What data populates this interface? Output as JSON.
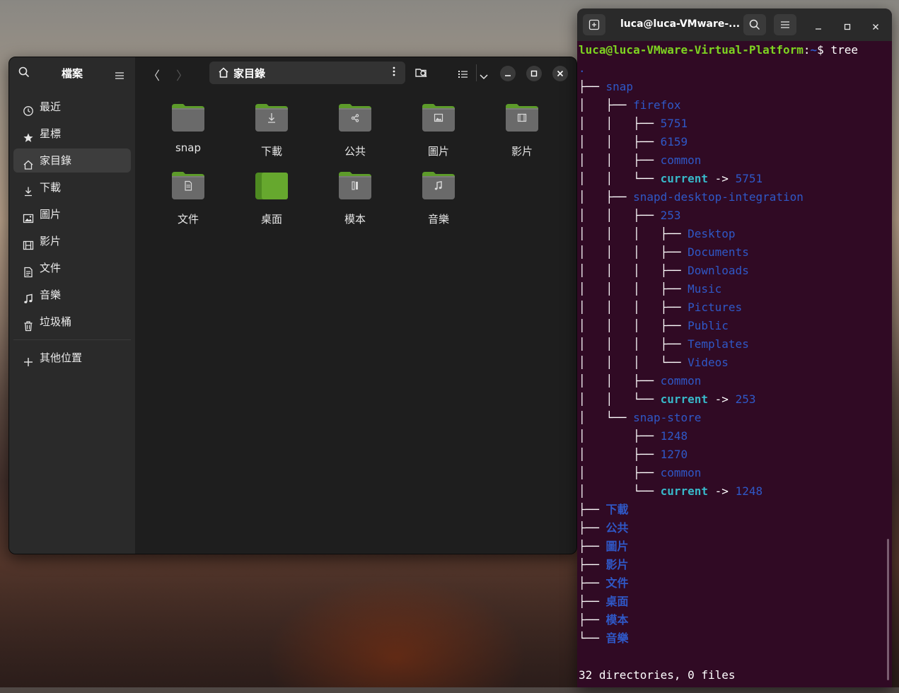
{
  "files": {
    "title": "檔案",
    "path": "家目錄",
    "sidebar": [
      {
        "label": "最近",
        "icon": "clock-icon"
      },
      {
        "label": "星標",
        "icon": "star-icon"
      },
      {
        "label": "家目錄",
        "icon": "home-icon"
      },
      {
        "label": "下載",
        "icon": "download-icon"
      },
      {
        "label": "圖片",
        "icon": "picture-icon"
      },
      {
        "label": "影片",
        "icon": "film-icon"
      },
      {
        "label": "文件",
        "icon": "document-icon"
      },
      {
        "label": "音樂",
        "icon": "music-icon"
      },
      {
        "label": "垃圾桶",
        "icon": "trash-icon"
      }
    ],
    "other_locations": "其他位置",
    "items": [
      {
        "label": "snap",
        "icon": "folder-icon"
      },
      {
        "label": "下載",
        "icon": "folder-download-icon"
      },
      {
        "label": "公共",
        "icon": "folder-share-icon"
      },
      {
        "label": "圖片",
        "icon": "folder-picture-icon"
      },
      {
        "label": "影片",
        "icon": "folder-video-icon"
      },
      {
        "label": "文件",
        "icon": "folder-document-icon"
      },
      {
        "label": "桌面",
        "icon": "folder-desktop-icon"
      },
      {
        "label": "模本",
        "icon": "folder-template-icon"
      },
      {
        "label": "音樂",
        "icon": "folder-music-icon"
      }
    ]
  },
  "terminal": {
    "title": "luca@luca-VMware-...",
    "prompt_user": "luca@luca-VMware-Virtual-Platform",
    "prompt_sep": ":",
    "prompt_path": "~",
    "prompt_sym": "$",
    "command": "tree",
    "root": ".",
    "lines": [
      {
        "prefix": "├── ",
        "name": "snap",
        "type": "dir"
      },
      {
        "prefix": "│   ├── ",
        "name": "firefox",
        "type": "dir"
      },
      {
        "prefix": "│   │   ├── ",
        "name": "5751",
        "type": "dir"
      },
      {
        "prefix": "│   │   ├── ",
        "name": "6159",
        "type": "dir"
      },
      {
        "prefix": "│   │   ├── ",
        "name": "common",
        "type": "dir"
      },
      {
        "prefix": "│   │   └── ",
        "name": "current",
        "type": "link",
        "target": "5751"
      },
      {
        "prefix": "│   ├── ",
        "name": "snapd-desktop-integration",
        "type": "dir"
      },
      {
        "prefix": "│   │   ├── ",
        "name": "253",
        "type": "dir"
      },
      {
        "prefix": "│   │   │   ├── ",
        "name": "Desktop",
        "type": "dir"
      },
      {
        "prefix": "│   │   │   ├── ",
        "name": "Documents",
        "type": "dir"
      },
      {
        "prefix": "│   │   │   ├── ",
        "name": "Downloads",
        "type": "dir"
      },
      {
        "prefix": "│   │   │   ├── ",
        "name": "Music",
        "type": "dir"
      },
      {
        "prefix": "│   │   │   ├── ",
        "name": "Pictures",
        "type": "dir"
      },
      {
        "prefix": "│   │   │   ├── ",
        "name": "Public",
        "type": "dir"
      },
      {
        "prefix": "│   │   │   ├── ",
        "name": "Templates",
        "type": "dir"
      },
      {
        "prefix": "│   │   │   └── ",
        "name": "Videos",
        "type": "dir"
      },
      {
        "prefix": "│   │   ├── ",
        "name": "common",
        "type": "dir"
      },
      {
        "prefix": "│   │   └── ",
        "name": "current",
        "type": "link",
        "target": "253"
      },
      {
        "prefix": "│   └── ",
        "name": "snap-store",
        "type": "dir"
      },
      {
        "prefix": "│       ├── ",
        "name": "1248",
        "type": "dir"
      },
      {
        "prefix": "│       ├── ",
        "name": "1270",
        "type": "dir"
      },
      {
        "prefix": "│       ├── ",
        "name": "common",
        "type": "dir"
      },
      {
        "prefix": "│       └── ",
        "name": "current",
        "type": "link",
        "target": "1248"
      },
      {
        "prefix": "├── ",
        "name": "下載",
        "type": "cjk"
      },
      {
        "prefix": "├── ",
        "name": "公共",
        "type": "cjk"
      },
      {
        "prefix": "├── ",
        "name": "圖片",
        "type": "cjk"
      },
      {
        "prefix": "├── ",
        "name": "影片",
        "type": "cjk"
      },
      {
        "prefix": "├── ",
        "name": "文件",
        "type": "cjk"
      },
      {
        "prefix": "├── ",
        "name": "桌面",
        "type": "cjk"
      },
      {
        "prefix": "├── ",
        "name": "模本",
        "type": "cjk"
      },
      {
        "prefix": "└── ",
        "name": "音樂",
        "type": "cjk"
      }
    ],
    "link_arrow": " -> ",
    "summary": "32 directories, 0 files"
  },
  "colors": {
    "dir": "#2f58c7",
    "link": "#38b8c9",
    "prompt": "#7ed321",
    "terminal_bg": "#300a24"
  }
}
